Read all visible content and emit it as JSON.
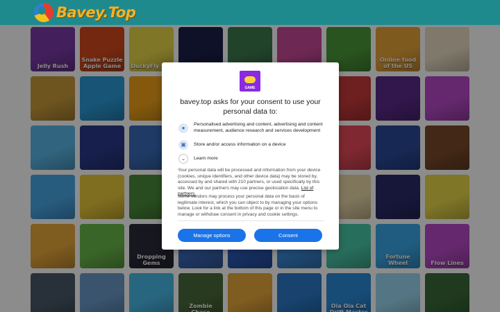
{
  "site": {
    "logo_text": "Bavey.Top"
  },
  "games": [
    {
      "label": "Jelly Rush",
      "color": "#7a3aa8"
    },
    {
      "label": "Snake Puzzle Apple Game",
      "color": "#d34a1c"
    },
    {
      "label": "DuckyFly Go!",
      "color": "#e9d84a"
    },
    {
      "label": "",
      "color": "#1c1f4a"
    },
    {
      "label": "",
      "color": "#3c7a4e"
    },
    {
      "label": "",
      "color": "#c84a9a"
    },
    {
      "label": "",
      "color": "#4c9a3a"
    },
    {
      "label": "Online food of the US",
      "color": "#e8a43a"
    },
    {
      "label": "",
      "color": "#e9dcc4"
    },
    {
      "label": "",
      "color": "#c89a3a"
    },
    {
      "label": "",
      "color": "#2a9ad8"
    },
    {
      "label": "",
      "color": "#f0a21a"
    },
    {
      "label": "",
      "color": "#d8382a"
    },
    {
      "label": "",
      "color": "#4a4a4a"
    },
    {
      "label": "",
      "color": "#e86a3a"
    },
    {
      "label": "",
      "color": "#c83a3a"
    },
    {
      "label": "",
      "color": "#5a2a8a"
    },
    {
      "label": "",
      "color": "#b84ac8"
    },
    {
      "label": "",
      "color": "#5ab8e8"
    },
    {
      "label": "",
      "color": "#2a3a8a"
    },
    {
      "label": "",
      "color": "#3a6ab8"
    },
    {
      "label": "",
      "color": "#c83a3a"
    },
    {
      "label": "",
      "color": "#2a7a5a"
    },
    {
      "label": "",
      "color": "#6a3a2a"
    },
    {
      "label": "",
      "color": "#e84a5a"
    },
    {
      "label": "",
      "color": "#2a4a9a"
    },
    {
      "label": "",
      "color": "#7a4a2a"
    },
    {
      "label": "",
      "color": "#4aa8e8"
    },
    {
      "label": "",
      "color": "#e8c83a"
    },
    {
      "label": "",
      "color": "#4a8a3a"
    },
    {
      "label": "",
      "color": "#3ac8e8"
    },
    {
      "label": "",
      "color": "#c83a2a"
    },
    {
      "label": "",
      "color": "#3a8ad8"
    },
    {
      "label": "",
      "color": "#e8d8a8"
    },
    {
      "label": "",
      "color": "#2a2a6a"
    },
    {
      "label": "",
      "color": "#e8d84a"
    },
    {
      "label": "",
      "color": "#e8a83a"
    },
    {
      "label": "",
      "color": "#6ab84a"
    },
    {
      "label": "Dropping Gems",
      "color": "#2a2a3a"
    },
    {
      "label": "",
      "color": "#3a6ab8"
    },
    {
      "label": "",
      "color": "#2a5ab8"
    },
    {
      "label": "",
      "color": "#3a8ad8"
    },
    {
      "label": "",
      "color": "#4ac8a8"
    },
    {
      "label": "Fortune Wheel",
      "color": "#3aa8e8"
    },
    {
      "label": "Flow Lines",
      "color": "#b84ac8"
    },
    {
      "label": "",
      "color": "#4a5a6a"
    },
    {
      "label": "",
      "color": "#6a9ac8"
    },
    {
      "label": "",
      "color": "#4ab8e8"
    },
    {
      "label": "Zombie Chase",
      "color": "#4a6a3a"
    },
    {
      "label": "",
      "color": "#e8a83a"
    },
    {
      "label": "",
      "color": "#2a7ac8"
    },
    {
      "label": "Oia Oia Cat Drift Master",
      "color": "#2a8ad8"
    },
    {
      "label": "",
      "color": "#9ad8f0"
    },
    {
      "label": "",
      "color": "#3a6a3a"
    }
  ],
  "consent": {
    "logo_caption": "GAME",
    "title": "bavey.top asks for your consent to use your personal data to:",
    "purposes": [
      {
        "icon": "user-icon",
        "text": "Personalised advertising and content, advertising and content measurement, audience research and services development"
      },
      {
        "icon": "device-icon",
        "text": "Store and/or access information on a device"
      }
    ],
    "learn_more": "Learn more",
    "paragraph1": "Your personal data will be processed and information from your device (cookies, unique identifiers, and other device data) may be stored by, accessed by and shared with 210 partners, or used specifically by this site. We and our partners may use precise geolocation data.",
    "partners_link": "List of partners.",
    "paragraph2": "Some vendors may process your personal data on the basis of legitimate interest, which you can object to by managing your options below. Look for a link at the bottom of this page or in the site menu to manage or withdraw consent in privacy and cookie settings.",
    "manage_label": "Manage options",
    "consent_label": "Consent"
  }
}
